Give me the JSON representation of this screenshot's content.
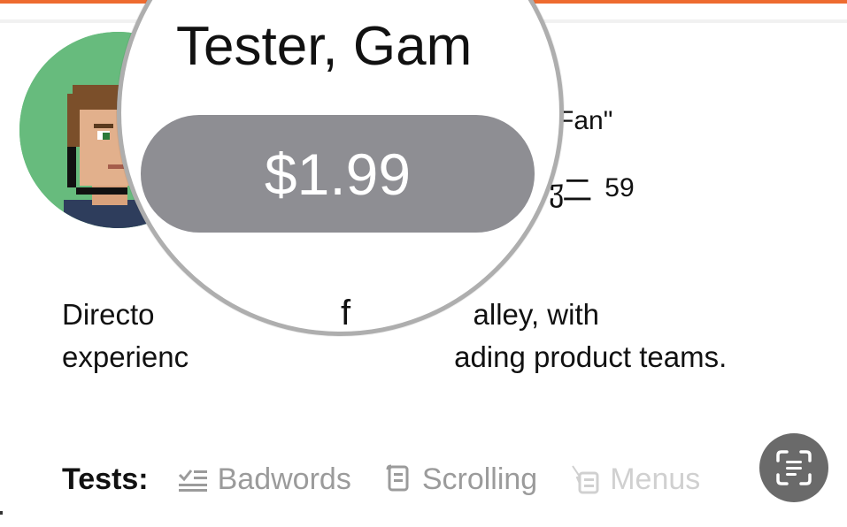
{
  "lens": {
    "title_fragment": "Tester, Gam",
    "price": "$1.99",
    "bottom_fragment": "f"
  },
  "profile": {
    "nickname_fragment": "Fan\"",
    "stat_value": "59",
    "bio_line1_left": "Directo",
    "bio_line1_right": "alley, with",
    "bio_line2_left": "experienc",
    "bio_line2_right": "ading product teams."
  },
  "tests": {
    "label": "Tests:",
    "items": [
      {
        "label": "Badwords",
        "icon": "checklist-icon"
      },
      {
        "label": "Scrolling",
        "icon": "scroll-icon"
      },
      {
        "label": "Menus",
        "icon": "menu-list-icon"
      }
    ]
  },
  "colors": {
    "accent": "#ee6b2f",
    "avatar_bg": "#67bb7d",
    "price_pill": "#8e8e93",
    "scan_button": "#6a6a6a"
  }
}
